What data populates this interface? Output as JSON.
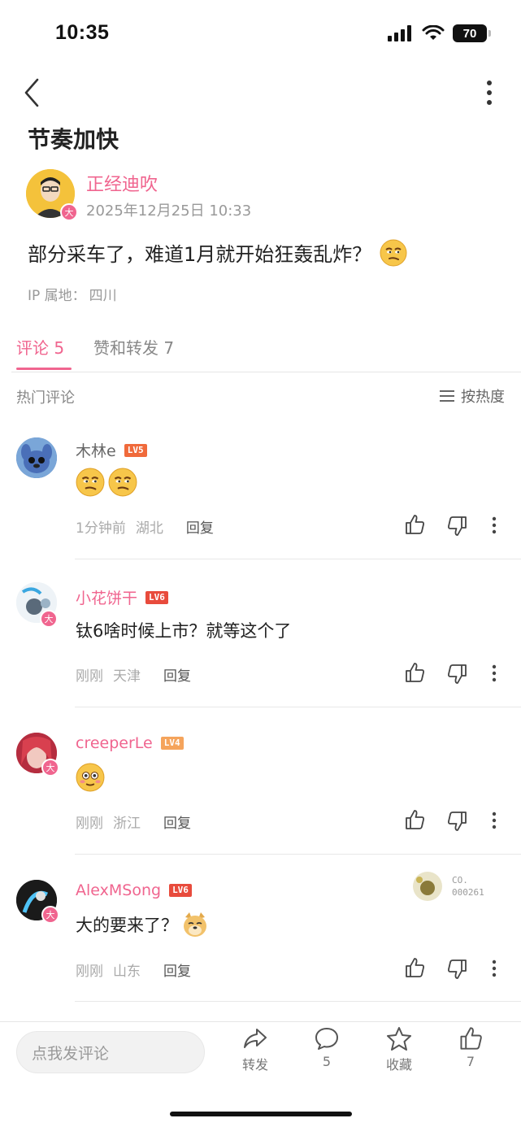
{
  "status_bar": {
    "time": "10:35",
    "battery": "70"
  },
  "nav": {
    "back_icon": "chevron-left-icon",
    "more_icon": "more-vertical-icon"
  },
  "post": {
    "title": "节奏加快",
    "author": {
      "name": "正经迪吹",
      "badge": "大"
    },
    "time": "2025年12月25日 10:33",
    "body": "部分采车了，难道1月就开始狂轰乱炸？",
    "emoji": "smirk-emoji",
    "ip_label": "IP 属地：",
    "ip_value": "四川"
  },
  "tabs": [
    {
      "label": "评论 5",
      "active": true
    },
    {
      "label": "赞和转发 7",
      "active": false
    }
  ],
  "comments_header": {
    "label": "热门评论",
    "sort_label": "按热度"
  },
  "comments": [
    {
      "name": "木林e",
      "name_color": "#666666",
      "level": "LV5",
      "level_color": "#f06a3b",
      "text": "",
      "emojis": [
        "smirk-emoji",
        "smirk-emoji"
      ],
      "time": "1分钟前",
      "location": "湖北",
      "reply": "回复",
      "badge": ""
    },
    {
      "name": "小花饼干",
      "name_color": "#f0658f",
      "level": "LV6",
      "level_color": "#e84b3c",
      "text": "钛6啥时候上市？就等这个了",
      "emojis": [],
      "time": "刚刚",
      "location": "天津",
      "reply": "回复",
      "badge": "大"
    },
    {
      "name": "creeperLe",
      "name_color": "#f0658f",
      "level": "LV4",
      "level_color": "#f5a45c",
      "text": "",
      "emojis": [
        "blush-emoji"
      ],
      "time": "刚刚",
      "location": "浙江",
      "reply": "回复",
      "badge": "大"
    },
    {
      "name": "AlexMSong",
      "name_color": "#f0658f",
      "level": "LV6",
      "level_color": "#e84b3c",
      "text": "大的要来了？",
      "emojis": [
        "doge-emoji"
      ],
      "time": "刚刚",
      "location": "山东",
      "reply": "回复",
      "badge": "大",
      "fan_card": {
        "line1": "CO.",
        "line2": "000261"
      }
    }
  ],
  "bottom_bar": {
    "input_placeholder": "点我发评论",
    "share_label": "转发",
    "comment_count": "5",
    "favorite_label": "收藏",
    "like_count": "7"
  },
  "colors": {
    "accent": "#f0658f",
    "text": "#222222",
    "muted": "#999999"
  }
}
